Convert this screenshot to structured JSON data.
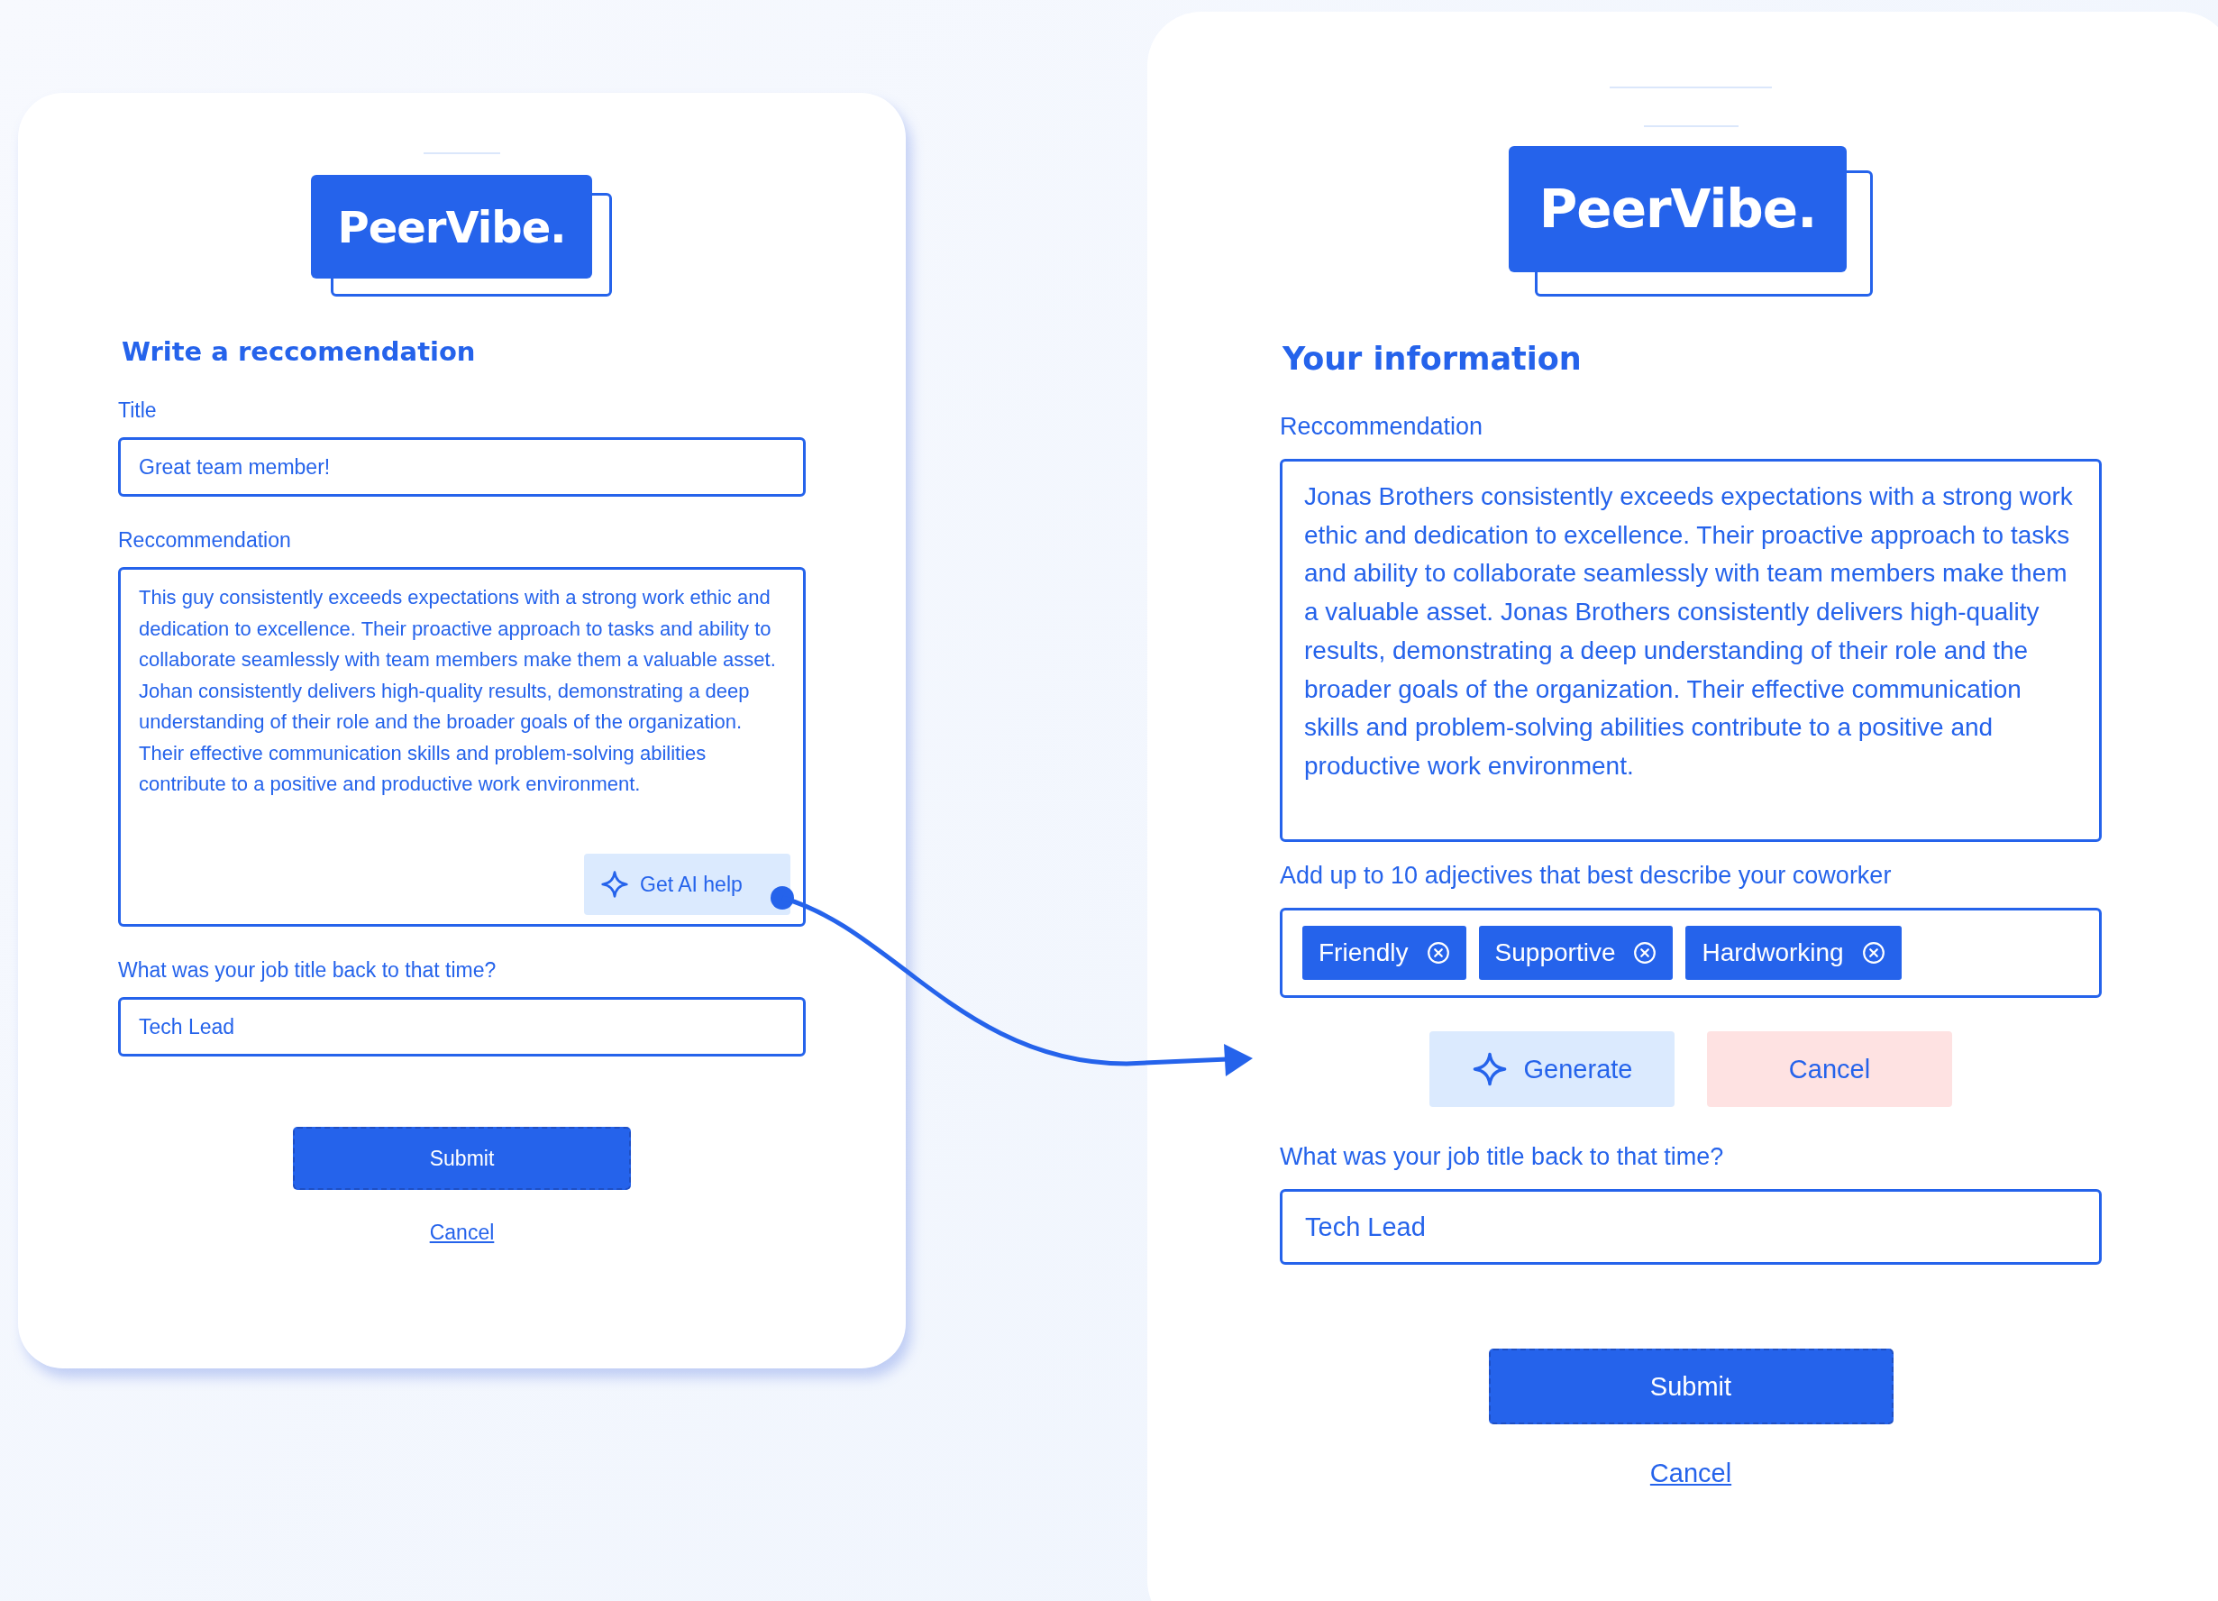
{
  "cards": [
    {
      "logo": "PeerVibe.",
      "heading": "Write a reccomendation",
      "fields": [
        {
          "kind": "input",
          "label": "Title",
          "value": "Great team member!"
        },
        {
          "kind": "textarea",
          "label": "Reccommendation",
          "value": "This guy consistently exceeds expectations with a strong work ethic and dedication to excellence. Their proactive approach to tasks and ability to collaborate seamlessly with team members make them a valuable asset. Johan consistently delivers high-quality results, demonstrating a deep understanding of their role and the broader goals of the organization. Their effective communication skills and problem-solving abilities contribute to a positive and productive work environment.",
          "ai_button": "Get AI help"
        },
        {
          "kind": "input",
          "label": "What was your job title back to that time?",
          "value": "Tech Lead"
        }
      ],
      "submit": "Submit",
      "cancel": "Cancel"
    },
    {
      "logo": "PeerVibe.",
      "heading": "Your information",
      "fields": [
        {
          "kind": "textarea",
          "label": "Reccommendation",
          "value": "Jonas Brothers consistently exceeds expectations with a strong work ethic and dedication to excellence. Their proactive approach to tasks and ability to collaborate seamlessly with team members make them a valuable asset. Jonas Brothers consistently delivers high-quality results, demonstrating a deep understanding of their role and the broader goals of the organization. Their effective communication skills and problem-solving abilities contribute to a positive and productive work environment."
        },
        {
          "kind": "tags",
          "label": "Add up to 10 adjectives that best describe your coworker",
          "tags": [
            "Friendly",
            "Supportive",
            "Hardworking"
          ]
        },
        {
          "kind": "actions",
          "buttons": [
            {
              "kind": "generate",
              "label": "Generate"
            },
            {
              "kind": "cancel",
              "label": "Cancel"
            }
          ]
        },
        {
          "kind": "input",
          "label": "What was your job title back to that time?",
          "value": "Tech Lead"
        }
      ],
      "submit": "Submit",
      "cancel": "Cancel"
    }
  ]
}
